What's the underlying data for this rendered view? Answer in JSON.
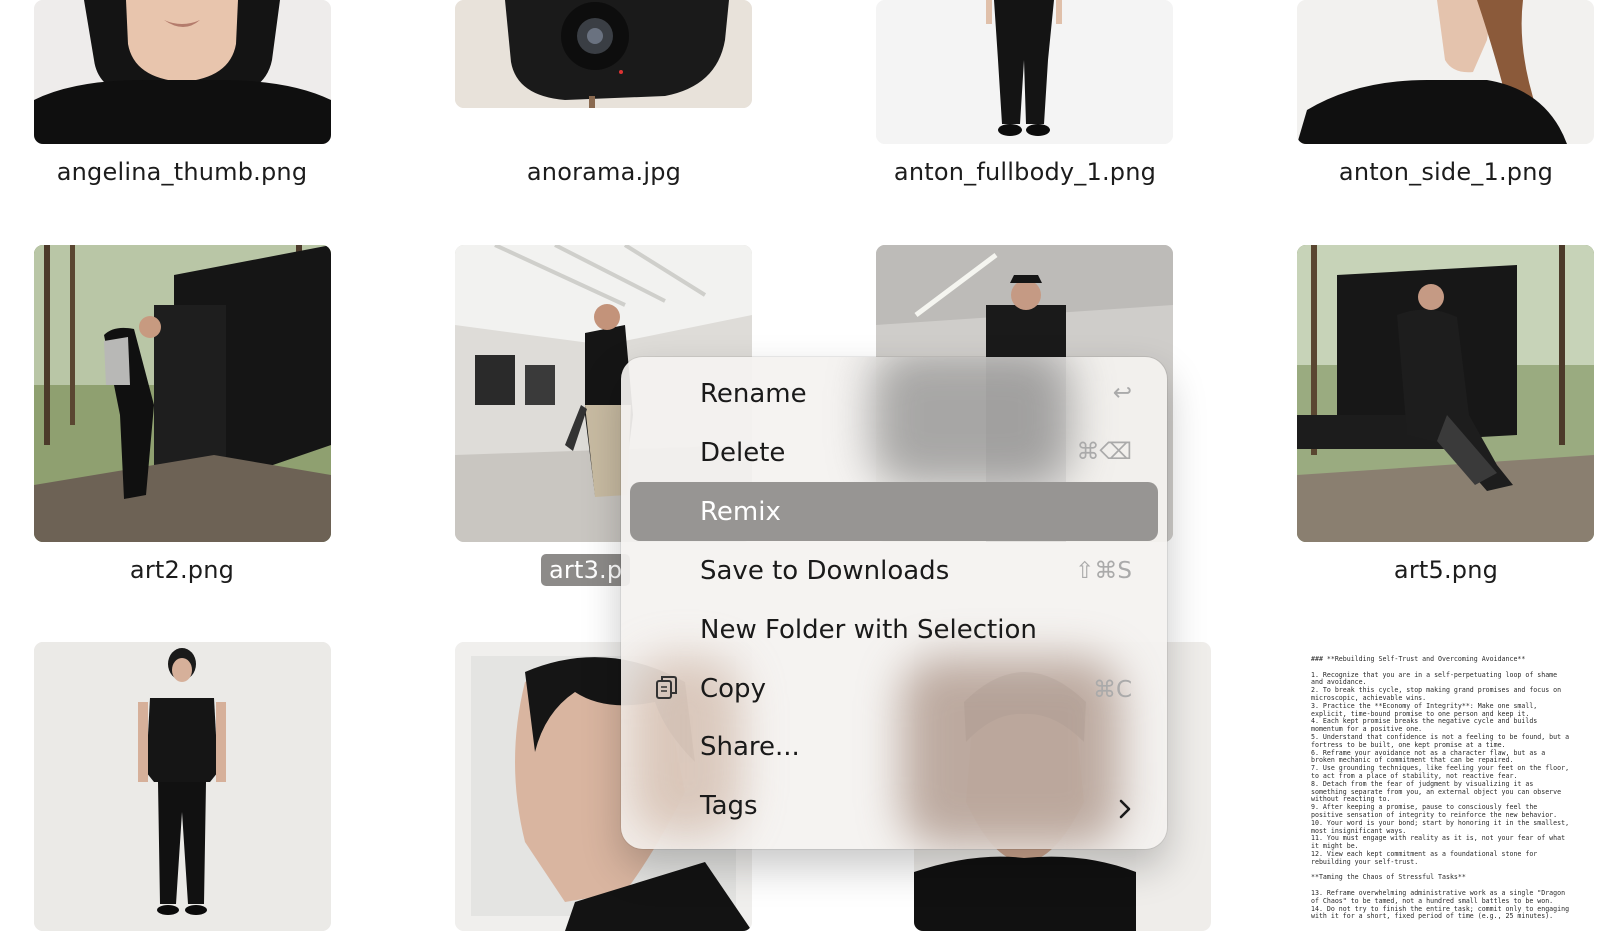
{
  "files": [
    {
      "name": "angelina_thumb.png"
    },
    {
      "name": "anorama.jpg"
    },
    {
      "name": "anton_fullbody_1.png"
    },
    {
      "name": "anton_side_1.png"
    },
    {
      "name": "art2.png"
    },
    {
      "name": "art3.p"
    },
    {
      "name": "art5.png"
    }
  ],
  "doc_thumb": {
    "lines": [
      "### **Rebuilding Self-Trust and Overcoming Avoidance**",
      "",
      "1. Recognize that you are in a self-perpetuating loop of shame",
      "and avoidance.",
      "2. To break this cycle, stop making grand promises and focus on",
      "microscopic, achievable wins.",
      "3. Practice the **Economy of Integrity**: Make one small,",
      "explicit, time-bound promise to one person and keep it.",
      "4. Each kept promise breaks the negative cycle and builds",
      "momentum for a positive one.",
      "5. Understand that confidence is not a feeling to be found, but a",
      "fortress to be built, one kept promise at a time.",
      "6. Reframe your avoidance not as a character flaw, but as a",
      "broken mechanic of commitment that can be repaired.",
      "7. Use grounding techniques, like feeling your feet on the floor,",
      "to act from a place of stability, not reactive fear.",
      "8. Detach from the fear of judgment by visualizing it as",
      "something separate from you, an external object you can observe",
      "without reacting to.",
      "9. After keeping a promise, pause to consciously feel the",
      "positive sensation of integrity to reinforce the new behavior.",
      "10. Your word is your bond; start by honoring it in the smallest,",
      "most insignificant ways.",
      "11. You must engage with reality as it is, not your fear of what",
      "it might be.",
      "12. View each kept commitment as a foundational stone for",
      "rebuilding your self-trust.",
      "",
      "**Taming the Chaos of Stressful Tasks**",
      "",
      "13. Reframe overwhelming administrative work as a single \"Dragon",
      "of Chaos\" to be tamed, not a hundred small battles to be won.",
      "14. Do not try to finish the entire task; commit only to engaging",
      "with it for a short, fixed period of time (e.g., 25 minutes)."
    ]
  },
  "context_menu": {
    "items": [
      {
        "label": "Rename",
        "shortcut": "↩",
        "icon": ""
      },
      {
        "label": "Delete",
        "shortcut": "⌘⌫",
        "icon": ""
      },
      {
        "label": "Remix",
        "shortcut": "",
        "icon": "",
        "highlighted": true
      },
      {
        "label": "Save to Downloads",
        "shortcut": "⇧⌘S",
        "icon": ""
      },
      {
        "label": "New Folder with Selection",
        "shortcut": "",
        "icon": ""
      },
      {
        "label": "Copy",
        "shortcut": "⌘C",
        "icon": "copy-icon"
      },
      {
        "label": "Share...",
        "shortcut": "",
        "icon": ""
      },
      {
        "label": "Tags",
        "shortcut": "",
        "icon": "chevron-right-icon"
      }
    ]
  },
  "colors": {
    "highlight": "#979593",
    "selected_label_bg": "#8d8b89",
    "menu_bg": "#f4f2f0"
  }
}
